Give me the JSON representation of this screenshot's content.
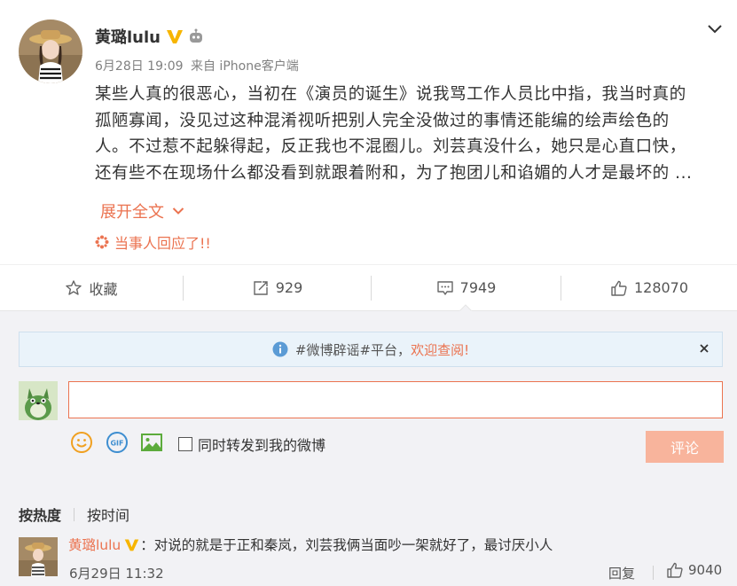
{
  "post": {
    "author": "黄璐lulu",
    "date": "6月28日 19:09",
    "source": "来自 iPhone客户端",
    "content_lines": [
      "某些人真的很恶心，当初在《演员的诞生》说我骂工作人员比中指，我当时真的",
      "孤陋寡闻，没见过这种混淆视听把别人完全没做过的事情还能编的绘声绘色的",
      "人。不过惹不起躲得起，反正我也不混圈儿。刘芸真没什么，她只是心直口快，",
      "还有些不在现场什么都没看到就跟着附和，为了抱团儿和谄媚的人才是最坏的 ..."
    ],
    "expand_label": "展开全文",
    "respond_label": "当事人回应了!!"
  },
  "actions": {
    "favorite_label": "收藏",
    "repost_count": "929",
    "comment_count": "7949",
    "like_count": "128070"
  },
  "notice": {
    "prefix": "#微博辟谣#平台，",
    "link": "欢迎查阅!"
  },
  "composer": {
    "input_value": "",
    "repost_label": "同时转发到我的微博",
    "submit_label": "评论"
  },
  "sort": {
    "hot_label": "按热度",
    "time_label": "按时间"
  },
  "comment": {
    "user": "黄璐lulu",
    "text": "：对说的就是于正和秦岚，刘芸我俩当面吵一架就好了，最讨厌小人",
    "time": "6月29日 11:32",
    "reply_label": "回复",
    "like_count": "9040"
  },
  "colors": {
    "accent": "#eb7350",
    "verified": "#f7b500",
    "panel_bg": "#f2f2f5",
    "notice_bg": "#eaf3fa",
    "submit_disabled": "#f8b49c"
  },
  "icons": [
    "chevron-down-icon",
    "verified-icon",
    "robot-icon",
    "star-icon",
    "repost-icon",
    "comment-icon",
    "thumbs-up-icon",
    "info-icon",
    "close-icon",
    "emoji-icon",
    "gif-icon",
    "image-icon"
  ]
}
